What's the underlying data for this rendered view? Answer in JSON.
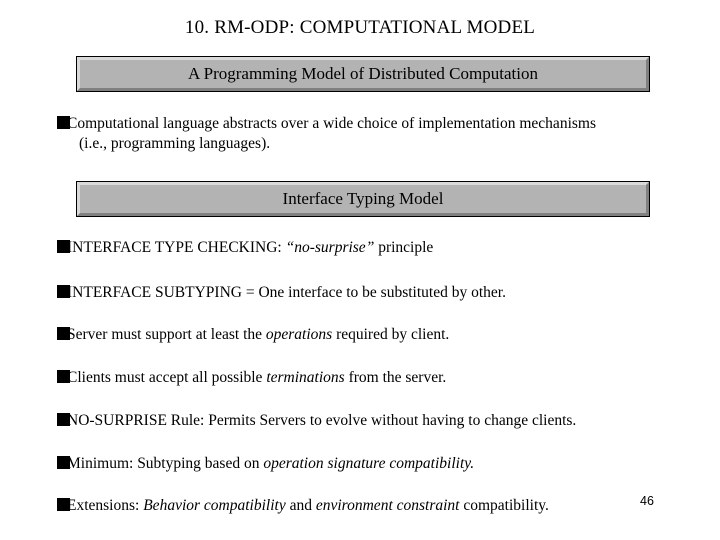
{
  "slide": {
    "title": "10. RM-ODP: COMPUTATIONAL MODEL",
    "page_number": "46",
    "colors": {
      "box_fill": "#b3b3b3",
      "box_border": "#000000",
      "bevel_light": "#d9d9d9",
      "bevel_shadow": "#808080",
      "text": "#000000",
      "background": "#ffffff"
    },
    "heading_boxes": [
      {
        "id": "programming-model",
        "label": "A Programming Model of Distributed Computation"
      },
      {
        "id": "interface-typing",
        "label": "Interface Typing Model"
      }
    ],
    "bullets": [
      {
        "id": "computational",
        "glyph": "filled-square-bullet",
        "line1": "Computational language abstracts over a wide choice of implementation mechanisms",
        "line2": "(i.e., programming languages)."
      },
      {
        "id": "type-checking",
        "glyph": "filled-square-bullet",
        "pre": "INTERFACE TYPE CHECKING: ",
        "italic": "“no-surprise”",
        "post": " principle"
      },
      {
        "id": "subtyping",
        "glyph": "filled-square-bullet",
        "pre": "INTERFACE SUBTYPING = One interface to be substituted by other.",
        "italic": "",
        "post": ""
      },
      {
        "id": "server",
        "glyph": "filled-square-bullet",
        "pre": "Server must support at least the ",
        "italic": "operations",
        "post": " required by client."
      },
      {
        "id": "clients",
        "glyph": "filled-square-bullet",
        "pre": "Clients must accept all possible ",
        "italic": "terminations",
        "post": " from the server."
      },
      {
        "id": "no-surprise",
        "glyph": "filled-square-bullet",
        "pre": "NO-SURPRISE Rule: Permits Servers to evolve without having to change clients.",
        "italic": "",
        "post": ""
      },
      {
        "id": "minimum",
        "glyph": "filled-square-bullet",
        "pre": "Minimum: Subtyping based on ",
        "italic": "operation signature compatibility.",
        "post": ""
      },
      {
        "id": "extensions",
        "glyph": "filled-square-bullet",
        "pre": "Extensions: ",
        "italic": "Behavior compatibility",
        "mid": " and ",
        "italic2": "environment constraint",
        "post": " compatibility."
      }
    ]
  }
}
